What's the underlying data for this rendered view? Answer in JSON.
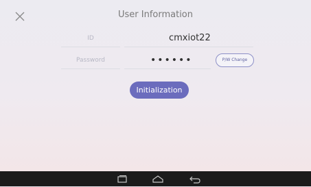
{
  "header": {
    "title": "User Information",
    "close_icon": "close-icon"
  },
  "form": {
    "id_label": "ID",
    "id_value": "cmxiot22",
    "password_label": "Password",
    "password_value": "••••••",
    "pw_change_label": "P/W Change"
  },
  "actions": {
    "initialization_label": "Initialization"
  },
  "colors": {
    "accent": "#6b6cbd",
    "navbar": "#1b1b1b"
  },
  "navbar": {
    "icons": [
      "recent-apps-icon",
      "home-icon",
      "back-icon"
    ]
  }
}
